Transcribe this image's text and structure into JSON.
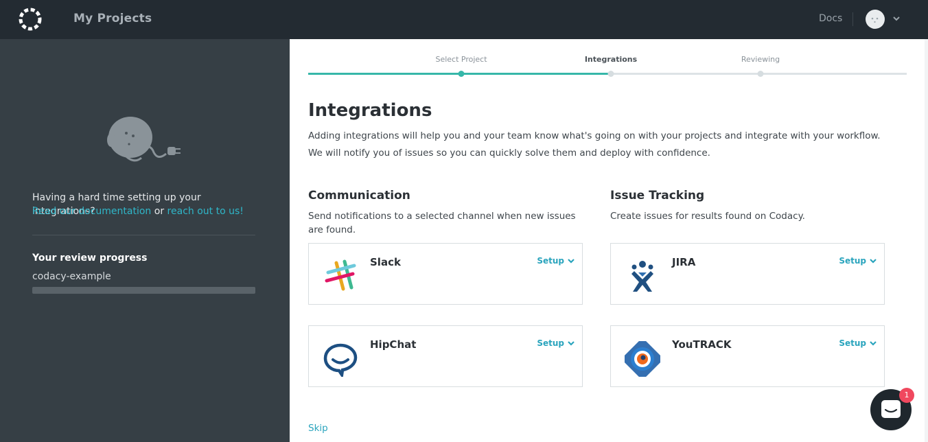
{
  "topbar": {
    "title": "My Projects",
    "docs_label": "Docs"
  },
  "sidebar": {
    "help_text": "Having a hard time setting up your integrations?",
    "docs_link": "Read our documentation",
    "or_text": "or",
    "contact_link": "reach out to us!",
    "progress_title": "Your review progress",
    "project_name": "codacy-example",
    "progress_fraction": 0
  },
  "stepper": {
    "steps": [
      {
        "label": "Select Project",
        "state": "done"
      },
      {
        "label": "Integrations",
        "state": "active"
      },
      {
        "label": "Reviewing",
        "state": "pending"
      }
    ]
  },
  "main": {
    "title": "Integrations",
    "intro_line1": "Adding integrations will help you and your team know what's going on with your projects and integrate with your workflow.",
    "intro_line2": "We will notify you of issues so you can quickly solve them and deploy with confidence.",
    "sections": [
      {
        "title": "Communication",
        "description": "Send notifications to a selected channel when new issues are found.",
        "integrations": [
          {
            "name": "Slack",
            "setup_label": "Setup",
            "icon": "slack-icon"
          },
          {
            "name": "HipChat",
            "setup_label": "Setup",
            "icon": "hipchat-icon"
          }
        ]
      },
      {
        "title": "Issue Tracking",
        "description": "Create issues for results found on Codacy.",
        "integrations": [
          {
            "name": "JIRA",
            "setup_label": "Setup",
            "icon": "jira-icon"
          },
          {
            "name": "YouTRACK",
            "setup_label": "Setup",
            "icon": "youtrack-icon"
          }
        ]
      }
    ],
    "skip_label": "Skip"
  },
  "chat": {
    "badge_count": "1"
  },
  "colors": {
    "topbar": "#232b32",
    "sidebar": "#363f45",
    "accent_teal": "#36b7a9",
    "link": "#2aa4bd",
    "badge": "#f0485e"
  }
}
